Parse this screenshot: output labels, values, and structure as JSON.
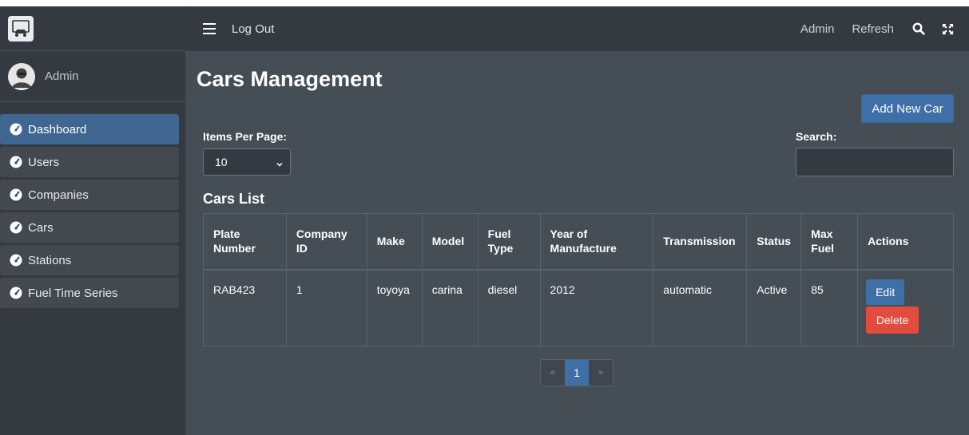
{
  "sidebar": {
    "brand_icon": "car-icon",
    "user": {
      "name": "Admin",
      "avatar_icon": "avatar-icon"
    },
    "items": [
      {
        "label": "Dashboard",
        "icon": "tachometer-icon",
        "active": true
      },
      {
        "label": "Users",
        "icon": "tachometer-icon"
      },
      {
        "label": "Companies",
        "icon": "tachometer-icon"
      },
      {
        "label": "Cars",
        "icon": "tachometer-icon"
      },
      {
        "label": "Stations",
        "icon": "tachometer-icon"
      },
      {
        "label": "Fuel Time Series",
        "icon": "tachometer-icon"
      }
    ]
  },
  "topbar": {
    "logout_label": "Log Out",
    "admin_label": "Admin",
    "refresh_label": "Refresh",
    "icons": [
      "menu-icon",
      "search-icon",
      "expand-icon"
    ]
  },
  "page": {
    "title": "Cars Management",
    "add_button": "Add New Car",
    "items_per_page_label": "Items Per Page:",
    "items_per_page_value": "10",
    "search_label": "Search:",
    "search_value": "",
    "list_title": "Cars List"
  },
  "table": {
    "headers": [
      "Plate Number",
      "Company ID",
      "Make",
      "Model",
      "Fuel Type",
      "Year of Manufacture",
      "Transmission",
      "Status",
      "Max Fuel",
      "Actions"
    ],
    "rows": [
      {
        "plate": "RAB423",
        "company_id": "1",
        "make": "toyoya",
        "model": "carina",
        "fuel_type": "diesel",
        "year": "2012",
        "transmission": "automatic",
        "status": "Active",
        "max_fuel": "85",
        "edit_label": "Edit",
        "delete_label": "Delete"
      }
    ]
  },
  "pagination": {
    "prev": "«",
    "current": "1",
    "next": "»"
  },
  "colors": {
    "primary": "#3e6fa7",
    "danger": "#e24c3f",
    "sidebar_bg": "#353a40",
    "content_bg": "#454d55"
  }
}
